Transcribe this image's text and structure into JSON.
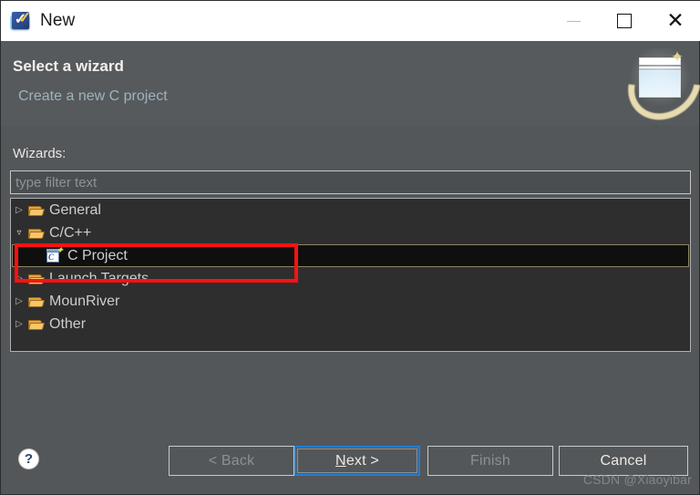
{
  "window": {
    "title": "New",
    "icon": "eclipse-new-wizard-icon",
    "controls": {
      "minimize": "minimize-icon",
      "maximize": "maximize-icon",
      "close": "close-icon"
    }
  },
  "header": {
    "title": "Select a wizard",
    "subtitle": "Create a new C project",
    "graphic": "new-window-sparkle-icon"
  },
  "body": {
    "wizards_label": "Wizards:",
    "filter": {
      "value": "",
      "placeholder": "type filter text"
    },
    "tree": [
      {
        "label": "General",
        "level": 0,
        "expanded": false,
        "selected": false,
        "icon": "folder-icon"
      },
      {
        "label": "C/C++",
        "level": 0,
        "expanded": true,
        "selected": false,
        "icon": "folder-icon"
      },
      {
        "label": "C Project",
        "level": 1,
        "expanded": null,
        "selected": true,
        "icon": "c-project-icon"
      },
      {
        "label": "Launch Targets",
        "level": 0,
        "expanded": false,
        "selected": false,
        "icon": "folder-icon"
      },
      {
        "label": "MounRiver",
        "level": 0,
        "expanded": false,
        "selected": false,
        "icon": "folder-icon"
      },
      {
        "label": "Other",
        "level": 0,
        "expanded": false,
        "selected": false,
        "icon": "folder-icon"
      }
    ],
    "annotation": {
      "shape": "rectangle",
      "color": "#fc1212",
      "targets": "C Project"
    }
  },
  "footer": {
    "help": "?",
    "buttons": {
      "back": {
        "label": "< Back",
        "enabled": false,
        "focused": false
      },
      "next": {
        "label": "Next >",
        "enabled": true,
        "focused": true,
        "mnemonic": "N"
      },
      "finish": {
        "label": "Finish",
        "enabled": false,
        "focused": false
      },
      "cancel": {
        "label": "Cancel",
        "enabled": true,
        "focused": false
      }
    }
  },
  "watermark": "CSDN @Xiaoyibar",
  "colors": {
    "dialog_bg": "#545759",
    "titlebar_bg": "#ffffff",
    "tree_bg": "#2e2e2e",
    "selection_bg": "#0f0f0f",
    "selection_border": "#8e8464",
    "accent_focus": "#1e7fd4",
    "annotation_red": "#fc1212",
    "subtitle_text": "#9fb3bd"
  }
}
